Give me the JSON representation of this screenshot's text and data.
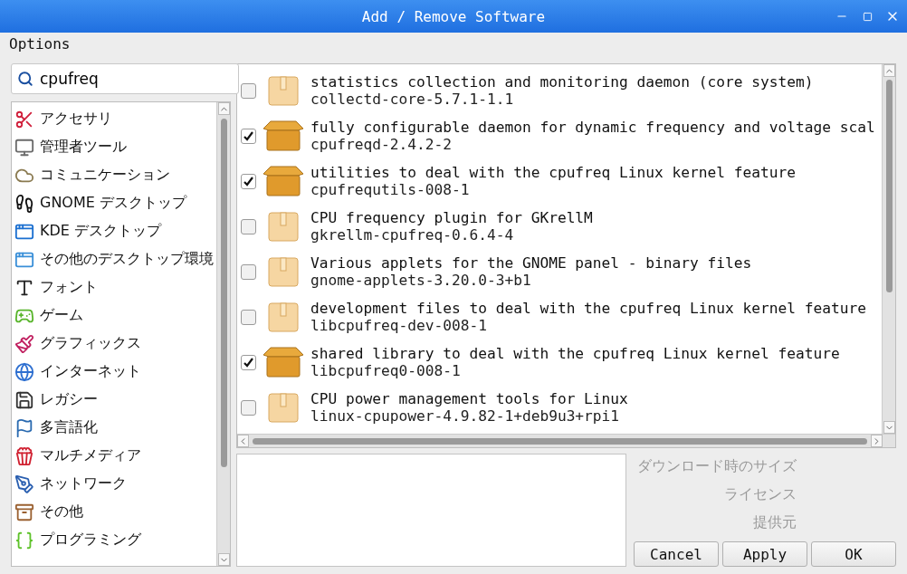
{
  "window": {
    "title": "Add / Remove Software"
  },
  "menu": [
    "Options"
  ],
  "search": {
    "value": "cpufreq"
  },
  "categories": [
    {
      "label": "アクセサリ"
    },
    {
      "label": "管理者ツール"
    },
    {
      "label": "コミュニケーション"
    },
    {
      "label": "GNOME デスクトップ"
    },
    {
      "label": "KDE デスクトップ"
    },
    {
      "label": "その他のデスクトップ環境"
    },
    {
      "label": "フォント"
    },
    {
      "label": "ゲーム"
    },
    {
      "label": "グラフィックス"
    },
    {
      "label": "インターネット"
    },
    {
      "label": "レガシー"
    },
    {
      "label": "多言語化"
    },
    {
      "label": "マルチメディア"
    },
    {
      "label": "ネットワーク"
    },
    {
      "label": "その他"
    },
    {
      "label": "プログラミング"
    }
  ],
  "packages": [
    {
      "summary": "statistics collection and monitoring daemon (core system)",
      "name": "collectd-core-5.7.1-1.1",
      "checked": false
    },
    {
      "summary": "fully configurable daemon for dynamic frequency and voltage scal",
      "name": "cpufreqd-2.4.2-2",
      "checked": true
    },
    {
      "summary": "utilities to deal with the cpufreq Linux kernel feature",
      "name": "cpufrequtils-008-1",
      "checked": true
    },
    {
      "summary": "CPU frequency plugin for GKrellM",
      "name": "gkrellm-cpufreq-0.6.4-4",
      "checked": false
    },
    {
      "summary": "Various applets for the GNOME panel - binary files",
      "name": "gnome-applets-3.20.0-3+b1",
      "checked": false
    },
    {
      "summary": "development files to deal with the cpufreq Linux kernel feature",
      "name": "libcpufreq-dev-008-1",
      "checked": false
    },
    {
      "summary": "shared library to deal with the cpufreq Linux kernel feature",
      "name": "libcpufreq0-008-1",
      "checked": true
    },
    {
      "summary": "CPU power management tools for Linux",
      "name": "linux-cpupower-4.9.82-1+deb9u3+rpi1",
      "checked": false
    }
  ],
  "details": {
    "labels": [
      "ダウンロード時のサイズ",
      "ライセンス",
      "提供元"
    ]
  },
  "buttons": [
    "Cancel",
    "Apply",
    "OK"
  ]
}
